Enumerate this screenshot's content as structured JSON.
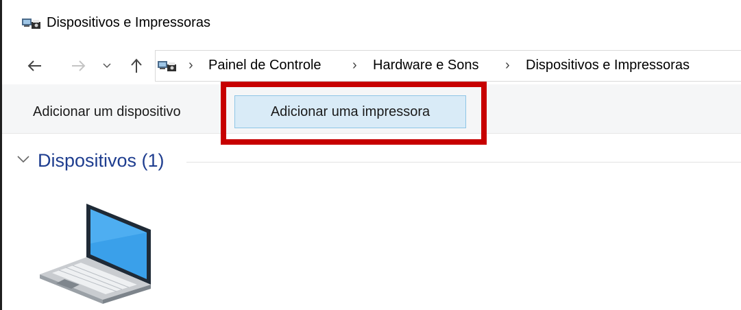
{
  "window": {
    "title": "Dispositivos e Impressoras",
    "icon": "devices-printers-icon"
  },
  "nav": {
    "back": "back-arrow-icon",
    "forward": "forward-arrow-icon",
    "recent": "chevron-down-icon",
    "up": "up-arrow-icon"
  },
  "breadcrumb": {
    "items": [
      "Painel de Controle",
      "Hardware e Sons",
      "Dispositivos e Impressoras"
    ],
    "separator": "›"
  },
  "commands": {
    "add_device": "Adicionar um dispositivo",
    "add_printer": "Adicionar uma impressora"
  },
  "group": {
    "title": "Dispositivos (1)"
  },
  "devices": [
    {
      "icon": "laptop-icon"
    }
  ],
  "colors": {
    "highlight": "#c70000",
    "group_title": "#1e3d8f",
    "button_hover_bg": "#d9ebf7",
    "button_hover_border": "#8ec5e6"
  }
}
